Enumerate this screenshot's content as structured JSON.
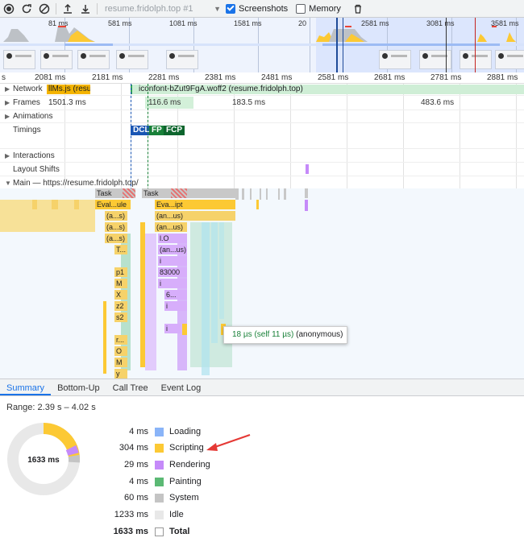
{
  "toolbar": {
    "recording_select": "resume.fridolph.top #1",
    "screenshots_label": "Screenshots",
    "screenshots_checked": true,
    "memory_label": "Memory",
    "memory_checked": false
  },
  "overview": {
    "ticks": [
      "81 ms",
      "581 ms",
      "1081 ms",
      "1581 ms",
      "20",
      "2581 ms",
      "3081 ms",
      "3581 ms"
    ]
  },
  "ruler": {
    "ticks": [
      "s",
      "2081 ms",
      "2181 ms",
      "2281 ms",
      "2381 ms",
      "2481 ms",
      "2581 ms",
      "2681 ms",
      "2781 ms",
      "2881 ms"
    ]
  },
  "tracks": {
    "network_label": "Network",
    "network_req1": "llMs.js (resu...",
    "network_req2": "iconfont-bZut9FgA.woff2 (resume.fridolph.top)",
    "frames_label": "Frames",
    "frames": [
      "1501.3 ms",
      "116.6 ms",
      "183.5 ms",
      "483.6 ms"
    ],
    "animations_label": "Animations",
    "timings_label": "Timings",
    "markers": [
      "DCL",
      "FP",
      "FCP"
    ],
    "interactions_label": "Interactions",
    "layout_shifts_label": "Layout Shifts",
    "main_label": "Main — https://resume.fridolph.top/"
  },
  "flame": {
    "col1": [
      "Task",
      "Eval...ule",
      "(a...s)",
      "(a...s)",
      "(a...s)",
      "T...",
      "p1",
      "M",
      "X",
      "z2",
      "s2",
      "",
      "r...",
      "O",
      "M",
      "y"
    ],
    "col2": [
      "Task",
      "Eva...ipt",
      "(an...us)",
      "(an...us)",
      "l.O",
      "(an...us)",
      "i",
      "83000",
      "i",
      "6...",
      "i",
      "",
      "i"
    ],
    "tooltip_time": "18 µs (self 11 µs)",
    "tooltip_name": "(anonymous)"
  },
  "bottom_tabs": [
    "Summary",
    "Bottom-Up",
    "Call Tree",
    "Event Log"
  ],
  "summary": {
    "range": "Range: 2.39 s – 4.02 s",
    "total_center": "1633 ms",
    "rows": [
      {
        "value": "4 ms",
        "label": "Loading",
        "color": "#8ab4f8"
      },
      {
        "value": "304 ms",
        "label": "Scripting",
        "color": "#fcc934"
      },
      {
        "value": "29 ms",
        "label": "Rendering",
        "color": "#c58af9"
      },
      {
        "value": "4 ms",
        "label": "Painting",
        "color": "#5bb974"
      },
      {
        "value": "60 ms",
        "label": "System",
        "color": "#c4c4c4"
      },
      {
        "value": "1233 ms",
        "label": "Idle",
        "color": "#e8e8e8"
      },
      {
        "value": "1633 ms",
        "label": "Total",
        "color": "#ffffff"
      }
    ]
  }
}
